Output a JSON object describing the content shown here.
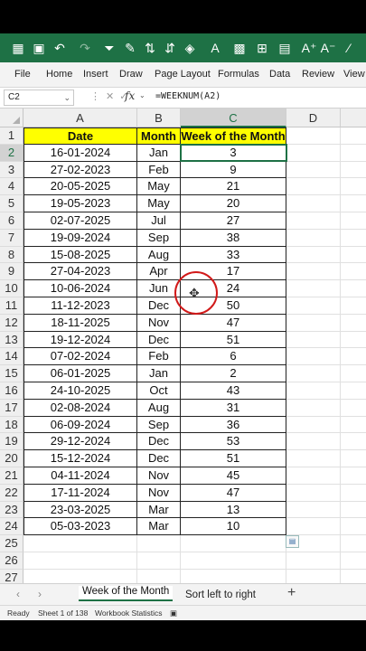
{
  "ribbon_tabs": [
    "File",
    "Home",
    "Insert",
    "Draw",
    "Page Layout",
    "Formulas",
    "Data",
    "Review",
    "View"
  ],
  "formula_bar": {
    "name_box": "C2",
    "fx": "fx",
    "formula": "=WEEKNUM(A2)"
  },
  "columns": [
    "A",
    "B",
    "C",
    "D"
  ],
  "headers": [
    "Date",
    "Month",
    "Week of the Month"
  ],
  "rows": [
    [
      "16-01-2024",
      "Jan",
      "3"
    ],
    [
      "27-02-2023",
      "Feb",
      "9"
    ],
    [
      "20-05-2025",
      "May",
      "21"
    ],
    [
      "19-05-2023",
      "May",
      "20"
    ],
    [
      "02-07-2025",
      "Jul",
      "27"
    ],
    [
      "19-09-2024",
      "Sep",
      "38"
    ],
    [
      "15-08-2025",
      "Aug",
      "33"
    ],
    [
      "27-04-2023",
      "Apr",
      "17"
    ],
    [
      "10-06-2024",
      "Jun",
      "24"
    ],
    [
      "11-12-2023",
      "Dec",
      "50"
    ],
    [
      "18-11-2025",
      "Nov",
      "47"
    ],
    [
      "19-12-2024",
      "Dec",
      "51"
    ],
    [
      "07-02-2024",
      "Feb",
      "6"
    ],
    [
      "06-01-2025",
      "Jan",
      "2"
    ],
    [
      "24-10-2025",
      "Oct",
      "43"
    ],
    [
      "02-08-2024",
      "Aug",
      "31"
    ],
    [
      "06-09-2024",
      "Sep",
      "36"
    ],
    [
      "29-12-2024",
      "Dec",
      "53"
    ],
    [
      "15-12-2024",
      "Dec",
      "51"
    ],
    [
      "04-11-2024",
      "Nov",
      "45"
    ],
    [
      "17-11-2024",
      "Nov",
      "47"
    ],
    [
      "23-03-2025",
      "Mar",
      "13"
    ],
    [
      "05-03-2023",
      "Mar",
      "10"
    ]
  ],
  "row_numbers": [
    "1",
    "2",
    "3",
    "4",
    "5",
    "6",
    "7",
    "8",
    "9",
    "10",
    "11",
    "12",
    "13",
    "14",
    "15",
    "16",
    "17",
    "18",
    "19",
    "20",
    "21",
    "22",
    "23",
    "24",
    "25",
    "26",
    "27"
  ],
  "sheet_tabs": {
    "active": "Week of the Month",
    "other": "Sort left to right"
  },
  "status": {
    "ready": "Ready",
    "sheet_info": "Sheet 1 of 138",
    "workbook_stats": "Workbook Statistics"
  },
  "colors": {
    "accent": "#1e7145",
    "header_fill": "#ffff00",
    "annotation": "#d11a1a"
  }
}
